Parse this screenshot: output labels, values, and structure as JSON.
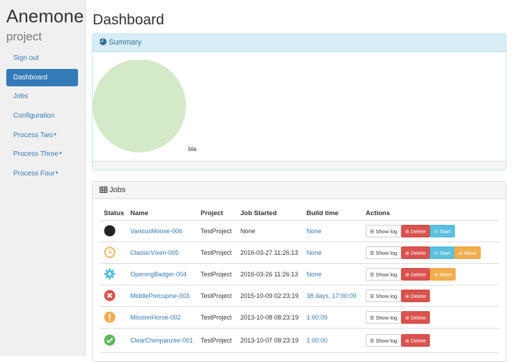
{
  "app": {
    "brand": "Anemone",
    "brand_sub": "project"
  },
  "sidebar": {
    "items": [
      {
        "label": "Sign out",
        "active": false
      },
      {
        "label": "Dashboard",
        "active": true
      },
      {
        "label": "Jobs",
        "active": false
      },
      {
        "label": "Configuration",
        "active": false
      },
      {
        "label": "Process Two",
        "dropdown": true
      },
      {
        "label": "Process Three",
        "dropdown": true
      },
      {
        "label": "Process Four",
        "dropdown": true
      }
    ]
  },
  "page": {
    "title": "Dashboard"
  },
  "summary": {
    "title": "Summary",
    "pie_label": "bla",
    "pie_color": "#d4e9c8",
    "pie_values": [
      1
    ]
  },
  "jobs": {
    "title": "Jobs",
    "columns": [
      "Status",
      "Name",
      "Project",
      "Job Started",
      "Build time",
      "Actions"
    ],
    "buttons": {
      "show_log": "Show log",
      "delete": "Delete",
      "start": "Start",
      "abort": "Abort"
    },
    "rows": [
      {
        "status": "idle-icon",
        "name": "VariousMoose-006",
        "project": "TestProject",
        "started": "None",
        "build_time": "None",
        "actions": [
          "show_log",
          "delete",
          "start"
        ]
      },
      {
        "status": "clock-icon",
        "name": "ClassicVixen-005",
        "project": "TestProject",
        "started": "2016-03-27 11:26:13",
        "build_time": "None",
        "actions": [
          "show_log",
          "delete",
          "start",
          "abort"
        ]
      },
      {
        "status": "gear-icon",
        "name": "OpeningBadger-004",
        "project": "TestProject",
        "started": "2016-03-26 11:26:13",
        "build_time": "None",
        "actions": [
          "show_log",
          "delete",
          "abort"
        ]
      },
      {
        "status": "error-icon",
        "name": "MiddlePorcupine-003",
        "project": "TestProject",
        "started": "2015-10-09 02:23:19",
        "build_time": "38 days, 17:00:09",
        "actions": [
          "show_log",
          "delete"
        ]
      },
      {
        "status": "warning-icon",
        "name": "MissionHorse-002",
        "project": "TestProject",
        "started": "2013-10-08 08:23:19",
        "build_time": "1:00:09",
        "actions": [
          "show_log",
          "delete"
        ]
      },
      {
        "status": "success-icon",
        "name": "ClearChimpanzee-001",
        "project": "TestProject",
        "started": "2013-10-07 08:23:19",
        "build_time": "1:00:00",
        "actions": [
          "show_log",
          "delete"
        ]
      }
    ]
  },
  "colors": {
    "primary": "#337ab7",
    "danger": "#d9534f",
    "info": "#5bc0de",
    "warning": "#f0ad4e",
    "success": "#5cb85c"
  }
}
